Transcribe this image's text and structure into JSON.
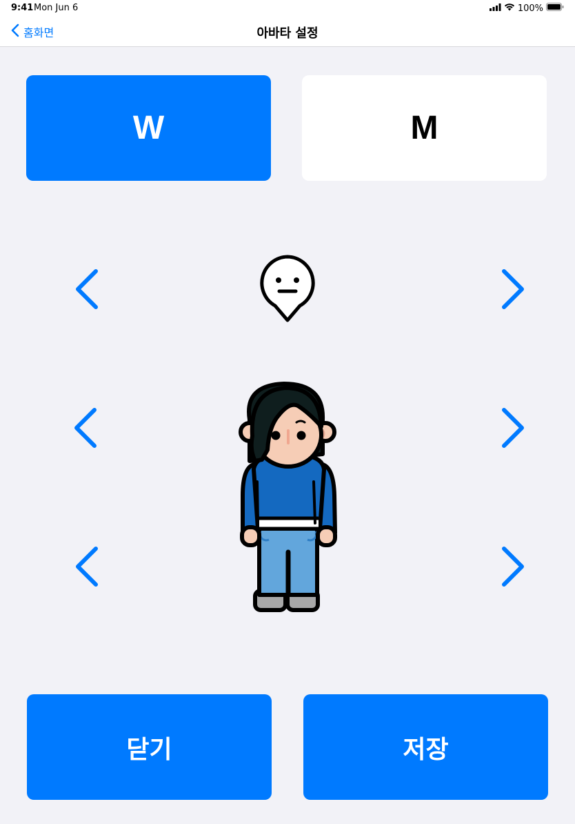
{
  "status_bar": {
    "time": "9:41",
    "date": "Mon Jun 6",
    "battery": "100%"
  },
  "nav": {
    "back_label": "홈화면",
    "title": "아바타 설정"
  },
  "gender": {
    "w_label": "W",
    "m_label": "M",
    "selected": "W"
  },
  "actions": {
    "close_label": "닫기",
    "save_label": "저장"
  },
  "colors": {
    "accent": "#007aff",
    "background": "#f2f2f7"
  }
}
